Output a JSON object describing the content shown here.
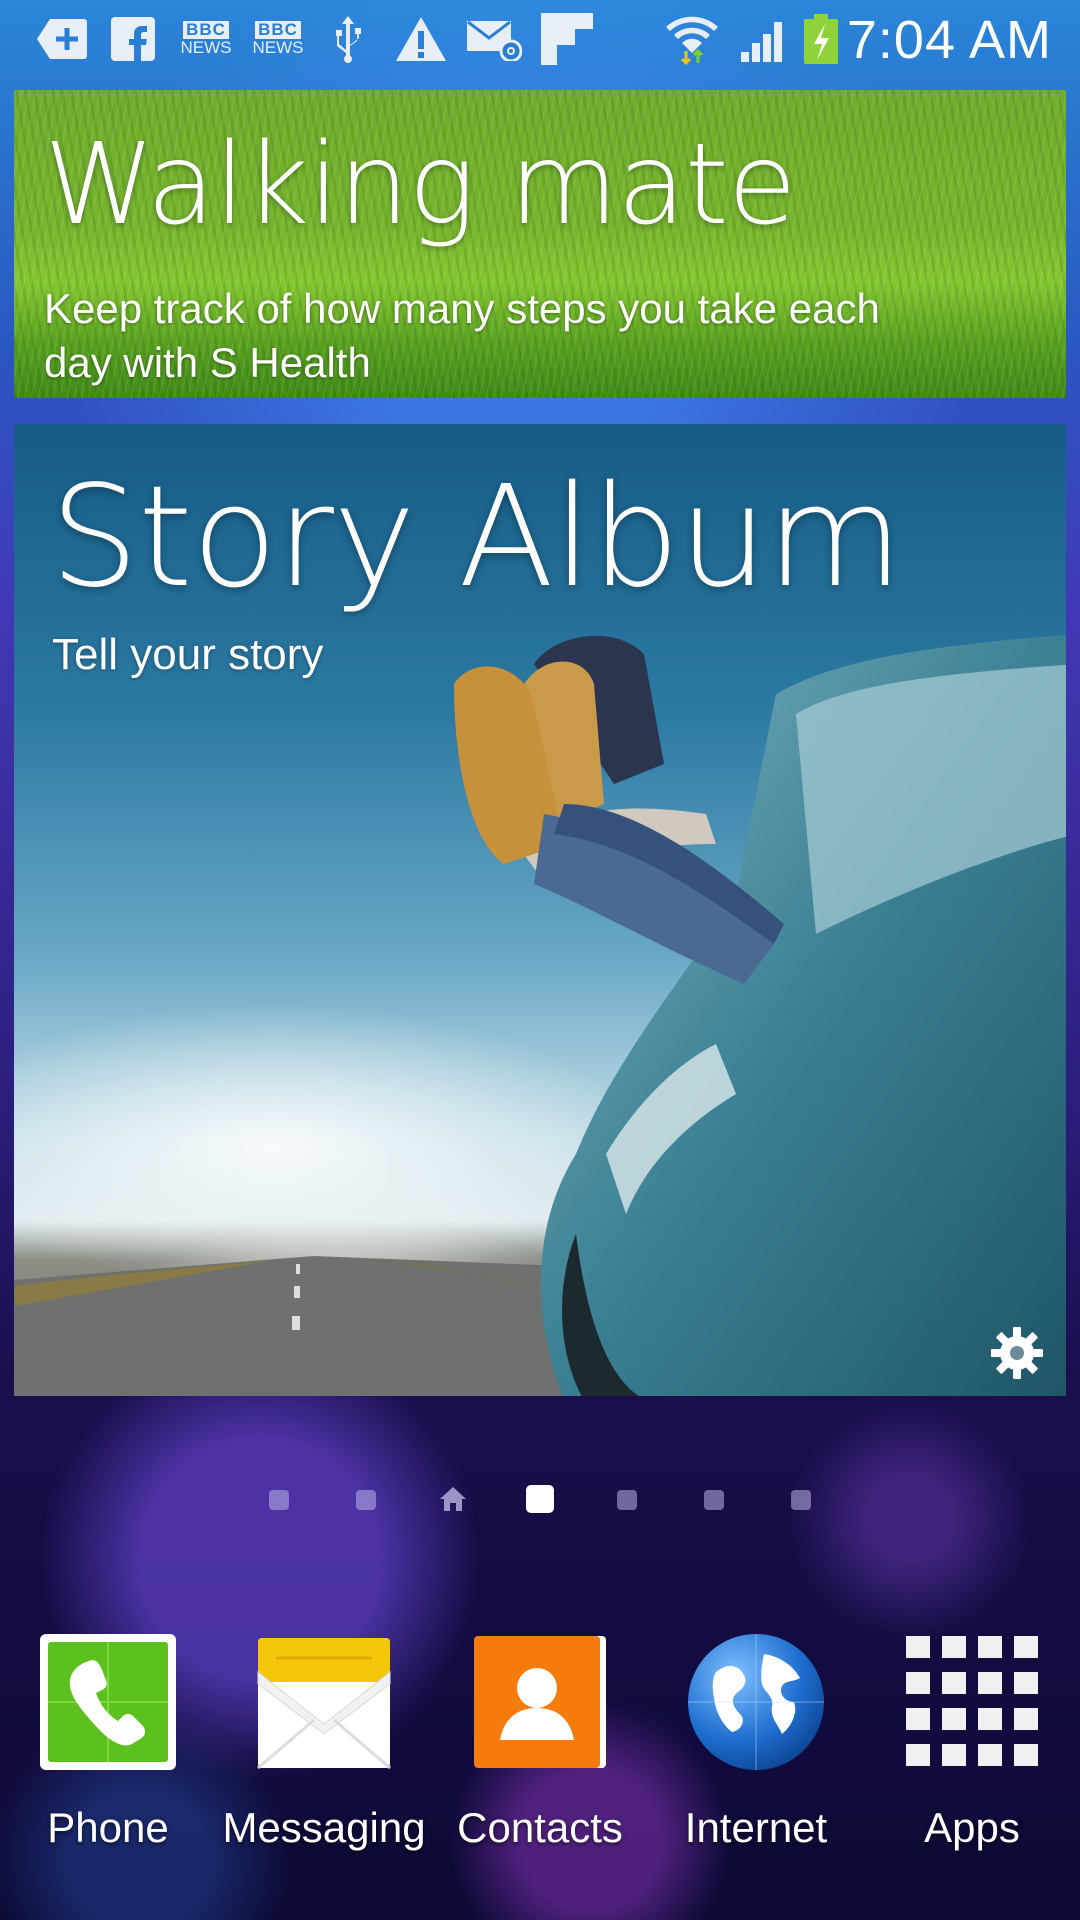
{
  "status_bar": {
    "time": "7:04 AM",
    "notification_icons": [
      "add-icon",
      "facebook-icon",
      "bbc-news-icon",
      "bbc-news-icon",
      "usb-icon",
      "warning-icon",
      "email-icon",
      "flipboard-icon"
    ],
    "bbc_news_labels": [
      "BBC",
      "NEWS"
    ],
    "system_icons": [
      "wifi-icon",
      "signal-icon",
      "battery-charging-icon"
    ]
  },
  "walking_mate": {
    "title": "Walking mate",
    "description": "Keep track of how many steps you take each day with S Health"
  },
  "story_album": {
    "title": "Story Album",
    "subtitle": "Tell your story",
    "settings_icon": "gear-icon"
  },
  "pager": {
    "page_count": 7,
    "home_index": 2,
    "active_index": 3
  },
  "dock": {
    "apps": [
      {
        "label": "Phone",
        "icon": "phone-icon"
      },
      {
        "label": "Messaging",
        "icon": "envelope-icon"
      },
      {
        "label": "Contacts",
        "icon": "contact-person-icon"
      },
      {
        "label": "Internet",
        "icon": "globe-icon"
      },
      {
        "label": "Apps",
        "icon": "app-grid-icon"
      }
    ]
  },
  "colors": {
    "walking_green": "#6fad2b",
    "phone_green": "#5cc11f",
    "messaging_yellow": "#f5c70a",
    "contacts_orange": "#f57b0c",
    "globe_blue": "#1f6fd0"
  }
}
